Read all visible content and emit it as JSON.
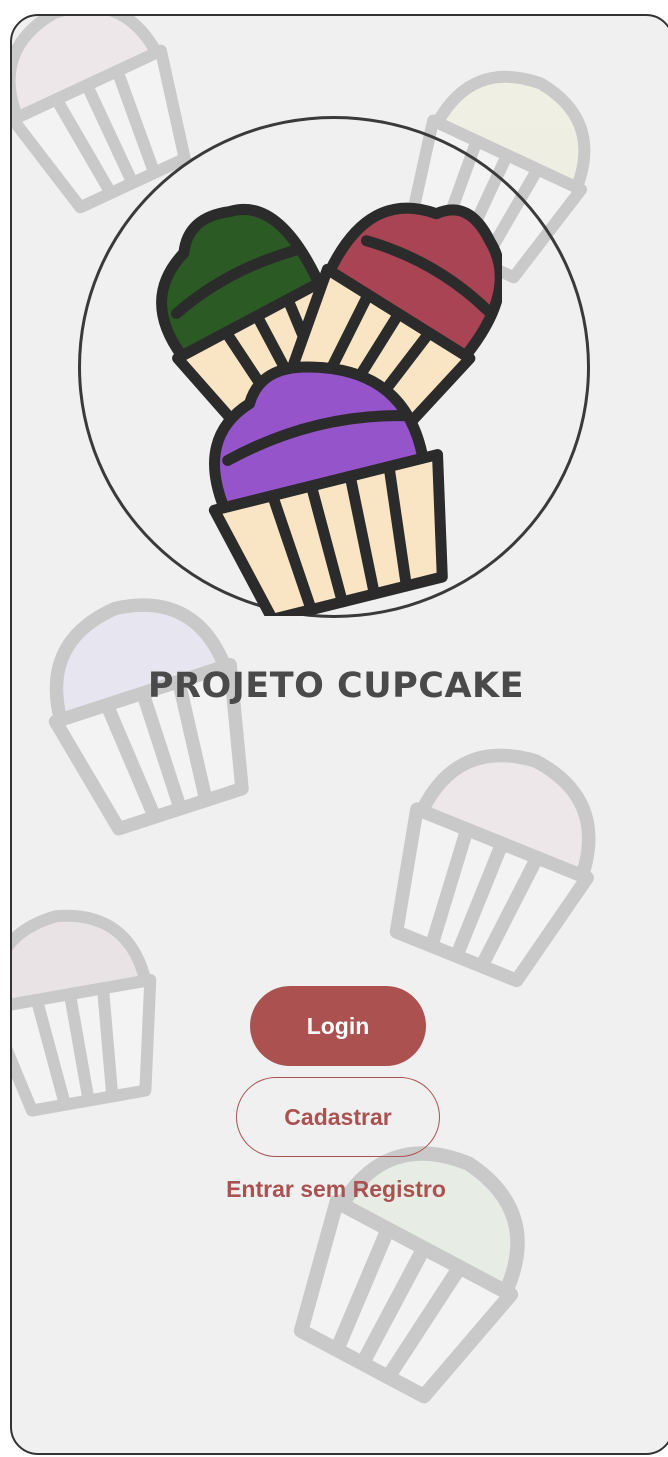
{
  "app": {
    "title": "PROJETO CUPCAKE"
  },
  "logo": {
    "icon": "cupcakes-logo-icon"
  },
  "background": {
    "icon": "cupcake-pattern-icon",
    "tints": [
      "#e9c9d3",
      "#ecebb8",
      "#c9c3f0",
      "#e6c9d2",
      "#d8b9c2",
      "#c8e6c2"
    ]
  },
  "actions": {
    "login_label": "Login",
    "register_label": "Cadastrar",
    "guest_label": "Entrar sem Registro"
  },
  "colors": {
    "accent": "#ab5251",
    "title": "#4a4a4a",
    "background": "#f0f0f0"
  }
}
